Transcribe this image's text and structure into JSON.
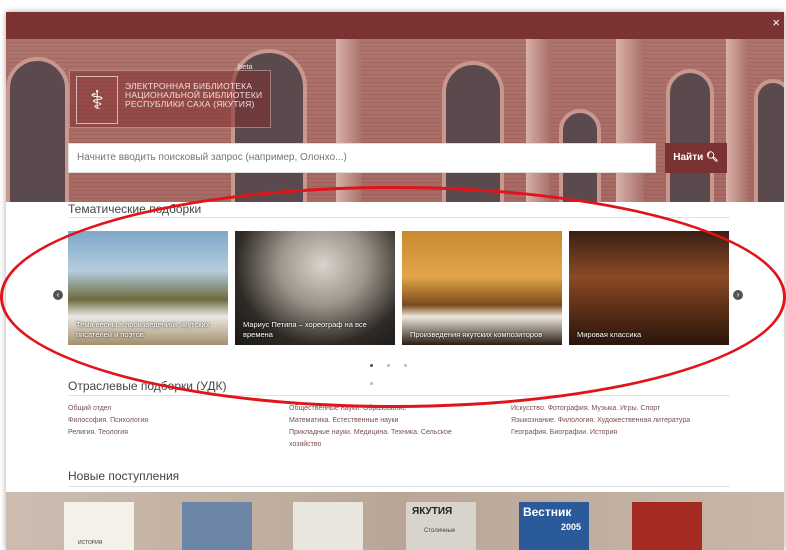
{
  "header": {
    "close_glyph": "×"
  },
  "logo": {
    "line1": "ЭЛЕКТРОННАЯ БИБЛИОТЕКА",
    "line2": "НАЦИОНАЛЬНОЙ БИБЛИОТЕКИ",
    "line3": "РЕСПУБЛИКИ САХА (ЯКУТИЯ)",
    "beta": "beta"
  },
  "search": {
    "placeholder": "Начните вводить поисковый запрос (например, Олонхо...)",
    "button_label": "Найти"
  },
  "thematic": {
    "title": "Тематические подборки",
    "slides": [
      {
        "caption": "Тема весны в произведениях якутских писателей и поэтов"
      },
      {
        "caption": "Мариус Петипа – хореограф на все времена"
      },
      {
        "caption": "Произведения якутских композиторов"
      },
      {
        "caption": "Мировая классика"
      }
    ]
  },
  "udk": {
    "title": "Отраслевые подборки (УДК)",
    "col1": [
      "Общий отдел",
      "Философия. Психология",
      "Религия. Теология"
    ],
    "col2": [
      "Общественные науки. Образование",
      "Математика. Естественные науки",
      "Прикладные науки. Медицина. Техника. Сельское",
      "хозяйство"
    ],
    "col3": [
      "Искусство. Фотография. Музыка. Игры. Спорт",
      "Языкознание. Филология. Художественная литература",
      "География. Биографии. История"
    ]
  },
  "new_arrivals": {
    "title": "Новые поступления",
    "labels": [
      "ИСТОРИЯ",
      "ЯКУТИЯ",
      "Вестник",
      "2005",
      "Столичные"
    ]
  },
  "colors": {
    "brand": "#7a3232",
    "annotation": "#e0141a"
  }
}
